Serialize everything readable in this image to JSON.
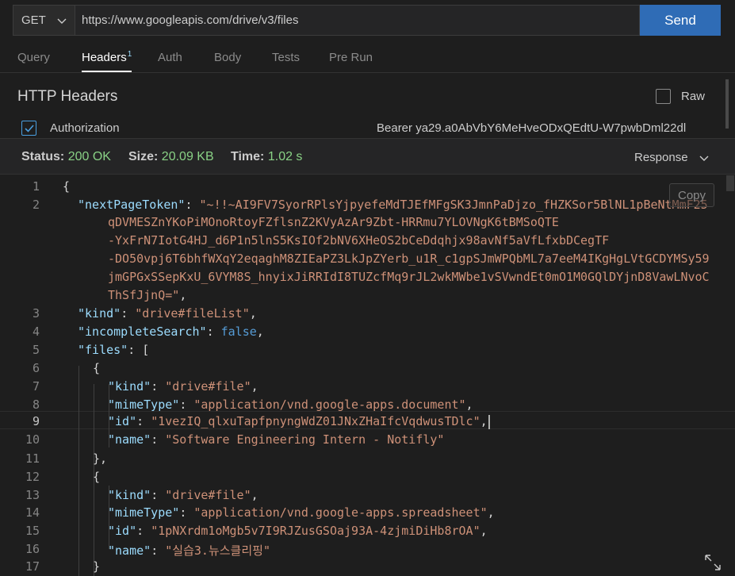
{
  "request": {
    "method": "GET",
    "url": "https://www.googleapis.com/drive/v3/files",
    "send_label": "Send"
  },
  "tabs": [
    {
      "label": "Query"
    },
    {
      "label": "Headers",
      "badge": "1",
      "active": true
    },
    {
      "label": "Auth"
    },
    {
      "label": "Body"
    },
    {
      "label": "Tests"
    },
    {
      "label": "Pre Run"
    }
  ],
  "headers_section": {
    "title": "HTTP Headers",
    "raw_label": "Raw",
    "raw_checked": false,
    "rows": [
      {
        "checked": true,
        "name": "Authorization",
        "value": "Bearer ya29.a0AbVbY6MeHveODxQEdtU-W7pwbDml22dl"
      }
    ]
  },
  "status": {
    "status_label": "Status:",
    "status_value": "200 OK",
    "size_label": "Size:",
    "size_value": "20.09 KB",
    "time_label": "Time:",
    "time_value": "1.02 s",
    "response_label": "Response"
  },
  "editor": {
    "copy_label": "Copy",
    "active_line": "9",
    "line_numbers": [
      "1",
      "2",
      "3",
      "4",
      "5",
      "6",
      "7",
      "8",
      "9",
      "10",
      "11",
      "12",
      "13",
      "14",
      "15",
      "16",
      "17"
    ],
    "next_page_token_lines": [
      "\"~!!~AI9FV7SyorRPlsYjpyefeMdTJEfMFgSK3JmnPaDjzo_fHZKSor5BlNL1pBeNtMmF25",
      "qDVMESZnYKoPiMOnoRtoyFZflsnZ2KVyAzAr9Zbt-HRRmu7YLOVNgK6tBMSoQTE",
      "-YxFrN7IotG4HJ_d6P1n5lnS5KsIOf2bNV6XHeOS2bCeDdqhjx98avNf5aVfLfxbDCegTF",
      "-DO50vpj6T6bhfWXqY2eqaghM8ZIEaPZ3LkJpZYerb_u1R_c1gpSJmWPQbML7a7eeM4IKgHgLVtGCDYMSy59",
      "jmGPGxSSepKxU_6VYM8S_hnyixJiRRIdI8TUZcfMq9rJL2wkMWbe1vSVwndEt0mO1M0GQlDYjnD8VawLNvoC",
      "ThSfJjnQ=\""
    ],
    "keys": {
      "nextPageToken": "\"nextPageToken\"",
      "kind": "\"kind\"",
      "incompleteSearch": "\"incompleteSearch\"",
      "files": "\"files\"",
      "mimeType": "\"mimeType\"",
      "id": "\"id\"",
      "name": "\"name\""
    },
    "root": {
      "kind": "\"drive#fileList\"",
      "incompleteSearch": "false"
    },
    "files": [
      {
        "kind": "\"drive#file\"",
        "mimeType": "\"application/vnd.google-apps.document\"",
        "id": "\"1vezIQ_qlxuTapfpnyngWdZ01JNxZHaIfcVqdwusTDlc\"",
        "name": "\"Software Engineering Intern - Notifly\""
      },
      {
        "kind": "\"drive#file\"",
        "mimeType": "\"application/vnd.google-apps.spreadsheet\"",
        "id": "\"1pNXrdm1oMgb5v7I9RJZusGSOaj93A-4zjmiDiHb8rOA\"",
        "name": "\"실습3.뉴스클리핑\""
      }
    ]
  }
}
